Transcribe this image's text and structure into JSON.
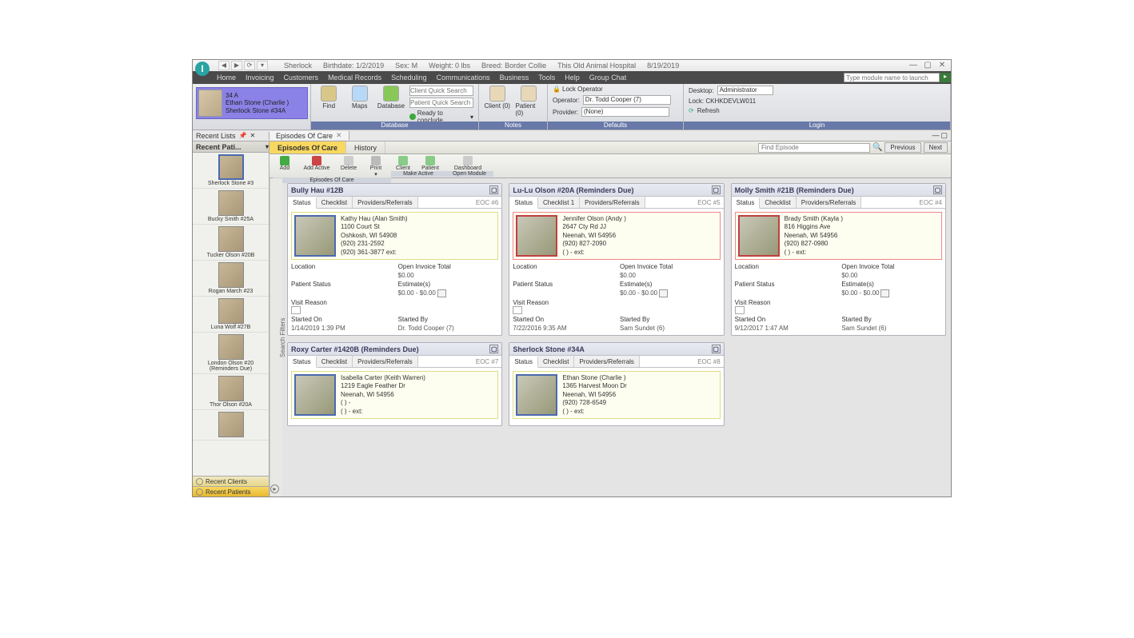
{
  "titlebar": {
    "patient_name": "Sherlock",
    "birthdate_label": "Birthdate:",
    "birthdate": "1/2/2019",
    "sex_label": "Sex:",
    "sex": "M",
    "weight_label": "Weight:",
    "weight": "0 lbs",
    "breed_label": "Breed:",
    "breed": "Border Collie",
    "hospital": "This Old Animal Hospital",
    "date": "8/19/2019"
  },
  "menubar": {
    "items": [
      "Home",
      "Invoicing",
      "Customers",
      "Medical Records",
      "Scheduling",
      "Communications",
      "Business",
      "Tools",
      "Help",
      "Group Chat"
    ],
    "search_placeholder": "Type module name to launch"
  },
  "ribbon": {
    "patient_badge": {
      "line1": "34    A",
      "line2": "Ethan Stone (Charlie )",
      "line3": "Sherlock Stone #34A"
    },
    "database_group": "Database",
    "find": "Find",
    "maps": "Maps",
    "database": "Database",
    "client_search_ph": "Client Quick Search",
    "patient_search_ph": "Patient Quick Search",
    "ready": "Ready to conclude",
    "client_btn": "Client (0)",
    "patient_btn": "Patient (0)",
    "notes_group": "Notes",
    "lock_op": "Lock Operator",
    "operator_label": "Operator:",
    "operator_value": "Dr. Todd Cooper (7)",
    "provider_label": "Provider:",
    "provider_value": "(None)",
    "defaults_group": "Defaults",
    "desktop_label": "Desktop:",
    "desktop_value": "Administrator",
    "lock_code": "Lock: CKHKDEVLW011",
    "refresh": "Refresh",
    "login_group": "Login"
  },
  "tabs": {
    "recent_lists": "Recent Lists",
    "eoc_tab": "Episodes Of Care"
  },
  "sidebar": {
    "header": "Recent Pati...",
    "items": [
      {
        "label": "Sherlock Stone #3"
      },
      {
        "label": "Bucky Smith #25A"
      },
      {
        "label": "Tucker Olson #20B"
      },
      {
        "label": "Rogan March #23"
      },
      {
        "label": "Luna Wolf #27B"
      },
      {
        "label": "London Olson #20 (Reminders Due)"
      },
      {
        "label": "Thor Olson #20A"
      },
      {
        "label": ""
      }
    ],
    "recent_clients": "Recent Clients",
    "recent_patients": "Recent Patients"
  },
  "main": {
    "subtabs": {
      "eoc": "Episodes Of Care",
      "history": "History"
    },
    "find_placeholder": "Find Episode",
    "previous": "Previous",
    "next": "Next",
    "toolbar": {
      "add": "Add",
      "add_active": "Add Active",
      "delete": "Delete",
      "print": "Print",
      "client": "Client",
      "patient": "Patient",
      "dashboard": "Dashboard",
      "group1": "Episodes Of Care",
      "group2": "Make Active",
      "group3": "Open Module"
    },
    "search_filter": "Search Filters",
    "cards": [
      {
        "title": "Bully Hau #12B",
        "tabs": [
          "Status",
          "Checklist",
          "Providers/Referrals"
        ],
        "eoc": "EOC #6",
        "owner": "Kathy Hau (Alan Smith)",
        "addr1": "1100 Court St",
        "addr2": "Oshkosh, WI 54908",
        "phone1": "(920) 231-2592",
        "phone2": "(920) 361-3877  ext:",
        "location_label": "Location",
        "open_inv_label": "Open Invoice Total",
        "open_inv": "$0.00",
        "patient_status_label": "Patient Status",
        "estimate_label": "Estimate(s)",
        "estimate": "$0.00 - $0.00",
        "visit_reason_label": "Visit Reason",
        "started_on_label": "Started On",
        "started_on": "1/14/2019 1:39 PM",
        "started_by_label": "Started By",
        "started_by": "Dr. Todd Cooper (7)",
        "thumb_style": ""
      },
      {
        "title": "Lu-Lu Olson #20A (Reminders Due)",
        "tabs": [
          "Status",
          "Checklist 1",
          "Providers/Referrals"
        ],
        "eoc": "EOC #5",
        "owner": "Jennifer Olson (Andy )",
        "addr1": "2647 Cty Rd JJ",
        "addr2": "Neenah, WI 54956",
        "phone1": "(920) 827-2090",
        "phone2": "(   )   -      ext:",
        "location_label": "Location",
        "open_inv_label": "Open Invoice Total",
        "open_inv": "$0.00",
        "patient_status_label": "Patient Status",
        "estimate_label": "Estimate(s)",
        "estimate": "$0.00 - $0.00",
        "visit_reason_label": "Visit Reason",
        "started_on_label": "Started On",
        "started_on": "7/22/2016 9:35 AM",
        "started_by_label": "Started By",
        "started_by": "Sam Sundet (6)",
        "thumb_style": "red"
      },
      {
        "title": "Molly Smith #21B (Reminders Due)",
        "tabs": [
          "Status",
          "Checklist",
          "Providers/Referrals"
        ],
        "eoc": "EOC #4",
        "owner": "Brady Smith (Kayla )",
        "addr1": "816 Higgins Ave",
        "addr2": "Neenah, WI 54956",
        "phone1": "(920) 827-0980",
        "phone2": "(   )   -      ext:",
        "location_label": "Location",
        "open_inv_label": "Open Invoice Total",
        "open_inv": "$0.00",
        "patient_status_label": "Patient Status",
        "estimate_label": "Estimate(s)",
        "estimate": "$0.00 - $0.00",
        "visit_reason_label": "Visit Reason",
        "started_on_label": "Started On",
        "started_on": "9/12/2017 1:47 AM",
        "started_by_label": "Started By",
        "started_by": "Sam Sundet (6)",
        "thumb_style": "red"
      },
      {
        "title": "Roxy Carter #1420B (Reminders Due)",
        "tabs": [
          "Status",
          "Checklist",
          "Providers/Referrals"
        ],
        "eoc": "EOC #7",
        "owner": "Isabella Carter (Keith Warren)",
        "addr1": "1219 Eagle Feather Dr",
        "addr2": "Neenah, WI 54956",
        "phone1": "(   )   -",
        "phone2": "(   )   -      ext:",
        "thumb_style": ""
      },
      {
        "title": "Sherlock Stone #34A",
        "tabs": [
          "Status",
          "Checklist",
          "Providers/Referrals"
        ],
        "eoc": "EOC #8",
        "owner": "Ethan Stone (Charlie )",
        "addr1": "1365 Harvest Moon Dr",
        "addr2": "Neenah, WI 54956",
        "phone1": "(920) 728-6549",
        "phone2": "(   )   -      ext:",
        "thumb_style": ""
      }
    ]
  }
}
